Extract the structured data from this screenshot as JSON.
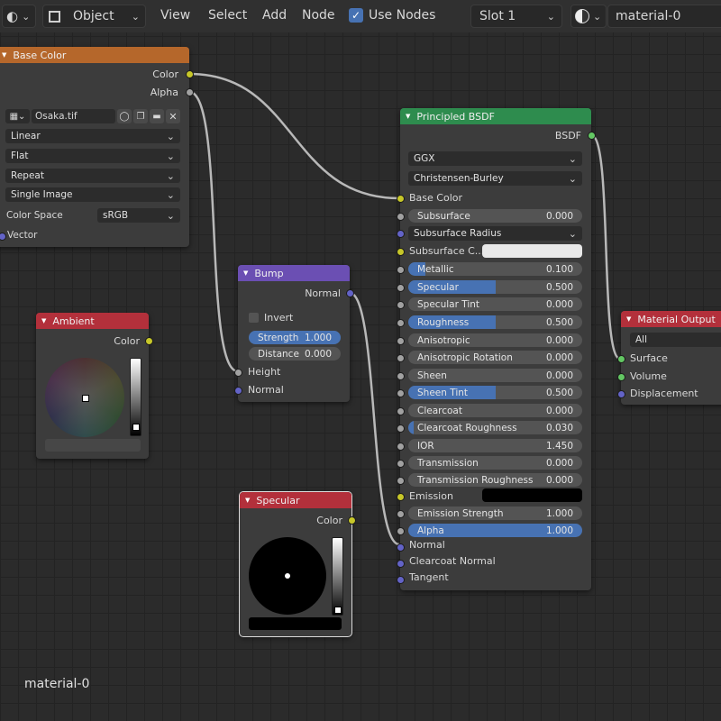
{
  "header": {
    "object_mode": "Object",
    "menus": [
      "View",
      "Select",
      "Add",
      "Node"
    ],
    "use_nodes_label": "Use Nodes",
    "use_nodes_checked": true,
    "slot": "Slot 1",
    "material": "material-0"
  },
  "image_node": {
    "title": "Base Color",
    "output_color": "Color",
    "output_alpha": "Alpha",
    "image_name": "Osaka.tif",
    "interpolation": "Linear",
    "projection": "Flat",
    "extension": "Repeat",
    "source": "Single Image",
    "color_space_label": "Color Space",
    "color_space": "sRGB",
    "input_vector": "Vector",
    "header_color": "#b5672b"
  },
  "ambient_node": {
    "title": "Ambient",
    "output": "Color",
    "header_color": "#b3303b"
  },
  "bump_node": {
    "title": "Bump",
    "output": "Normal",
    "invert_label": "Invert",
    "strength_label": "Strength",
    "strength_value": "1.000",
    "distance_label": "Distance",
    "distance_value": "0.000",
    "input_height": "Height",
    "input_normal": "Normal",
    "header_color": "#6b4fb3"
  },
  "specular_node": {
    "title": "Specular",
    "output": "Color",
    "header_color": "#b3303b"
  },
  "bsdf_node": {
    "title": "Principled BSDF",
    "output": "BSDF",
    "distribution": "GGX",
    "subsurface_method": "Christensen-Burley",
    "base_color_label": "Base Color",
    "subsurface_label": "Subsurface",
    "subsurface_value": "0.000",
    "subsurface_radius_label": "Subsurface Radius",
    "subsurface_color_label": "Subsurface C...",
    "metallic_label": "Metallic",
    "metallic_value": "0.100",
    "metallic_fill": 0.1,
    "specular_label": "Specular",
    "specular_value": "0.500",
    "specular_fill": 0.5,
    "specular_tint_label": "Specular Tint",
    "specular_tint_value": "0.000",
    "roughness_label": "Roughness",
    "roughness_value": "0.500",
    "roughness_fill": 0.5,
    "anisotropic_label": "Anisotropic",
    "anisotropic_value": "0.000",
    "anisotropic_rotation_label": "Anisotropic Rotation",
    "anisotropic_rotation_value": "0.000",
    "sheen_label": "Sheen",
    "sheen_value": "0.000",
    "sheen_tint_label": "Sheen Tint",
    "sheen_tint_value": "0.500",
    "sheen_tint_fill": 0.5,
    "clearcoat_label": "Clearcoat",
    "clearcoat_value": "0.000",
    "clearcoat_roughness_label": "Clearcoat Roughness",
    "clearcoat_roughness_value": "0.030",
    "clearcoat_roughness_fill": 0.03,
    "ior_label": "IOR",
    "ior_value": "1.450",
    "transmission_label": "Transmission",
    "transmission_value": "0.000",
    "transmission_roughness_label": "Transmission Roughness",
    "transmission_roughness_value": "0.000",
    "emission_label": "Emission",
    "emission_strength_label": "Emission Strength",
    "emission_strength_value": "1.000",
    "alpha_label": "Alpha",
    "alpha_value": "1.000",
    "alpha_fill": 1.0,
    "normal_label": "Normal",
    "clearcoat_normal_label": "Clearcoat Normal",
    "tangent_label": "Tangent",
    "header_color": "#2e8c4e"
  },
  "output_node": {
    "title": "Material Output",
    "target": "All",
    "surface": "Surface",
    "volume": "Volume",
    "displacement": "Displacement",
    "header_color": "#b3303b"
  },
  "footer": {
    "material_name": "material-0"
  }
}
